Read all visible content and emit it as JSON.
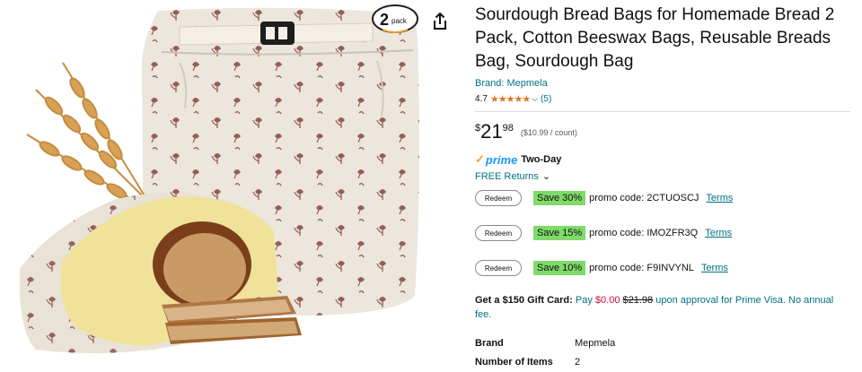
{
  "badge": {
    "number": "2",
    "label": "pack"
  },
  "product": {
    "title": "Sourdough Bread Bags for Homemade Bread 2 Pack, Cotton Beeswax Bags, Reusable Breads Bag, Sourdough Bag",
    "brand_link": "Brand: Mepmela",
    "rating_value": "4.7",
    "stars": "★★★★★",
    "rating_count": "(5)"
  },
  "price": {
    "currency": "$",
    "whole": "21",
    "fraction": "98",
    "unit": "($10.99 / count)"
  },
  "shipping": {
    "prime": "prime",
    "two_day": "Two-Day",
    "returns": "FREE Returns"
  },
  "promos": [
    {
      "redeem": "Redeem",
      "save": "Save 30%",
      "code": "promo code: 2CTUOSCJ",
      "terms": "Terms"
    },
    {
      "redeem": "Redeem",
      "save": "Save 15%",
      "code": "promo code: IMOZFR3Q",
      "terms": "Terms"
    },
    {
      "redeem": "Redeem",
      "save": "Save 10%",
      "code": "promo code: F9INVYNL",
      "terms": "Terms"
    }
  ],
  "gift": {
    "lead": "Get a $150 Gift Card:",
    "pay": "Pay",
    "price": "$0.00",
    "old_price": "$21.98",
    "rest": "upon approval for Prime Visa. No annual fee."
  },
  "specs": [
    {
      "key": "Brand",
      "value": "Mepmela"
    },
    {
      "key": "Number of Items",
      "value": "2"
    }
  ],
  "colors": {
    "link": "#007185",
    "save_bg": "#7fda69",
    "star": "#de7921",
    "prime": "#1a98ff"
  },
  "icons": {
    "share": "share-icon",
    "chevron": "chevron-down-icon",
    "prime_check": "prime-check-icon"
  }
}
